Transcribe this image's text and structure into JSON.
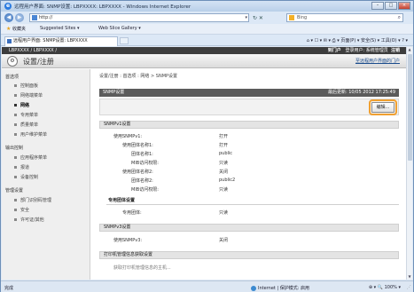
{
  "window": {
    "title": "远程用户界面: SNMP设置: LBPXXXX: LBPXXXX - Windows Internet Explorer",
    "minimize": "–",
    "maximize": "□",
    "close": "×"
  },
  "address_bar": {
    "back": "◀",
    "forward": "▶",
    "url": "http://",
    "refresh": "↻ ✕",
    "search_placeholder": "Bing",
    "search_glyph": "⌕"
  },
  "favorites_bar": {
    "favorites_label": "收藏夹",
    "suggested_sites": "Suggested Sites ▾",
    "web_slice_gallery": "Web Slice Gallery ▾"
  },
  "tab": {
    "label": "远程用户界面: SNMP设置: LBPXXXX"
  },
  "command_bar": {
    "text": "⌂ ▾  ☐ ▾  ✉ ▾  ⎙ ▾  页面(P) ▾  安全(S) ▾  工具(O) ▾  ? ▾"
  },
  "page_header": {
    "device_name": "LBPXXXX / LBPXXXX /",
    "to_portal": "到门户",
    "login_user_label": "登录用户:",
    "login_user_value": "系统管理员",
    "logout": "注销",
    "title": "设置/注册",
    "settings_icon_glyph": "⚙",
    "portal_link": "至远程用户界面的门户"
  },
  "sidebar": {
    "sections": [
      {
        "label": "首选项",
        "items": [
          "控制面板",
          "网络端菜单",
          "网络",
          "专用菜单",
          "质量菜单",
          "用户维护菜单"
        ]
      },
      {
        "label": "输出控制",
        "items": [
          "应用程序菜单",
          "报道",
          "设备控制"
        ]
      },
      {
        "label": "管理设置",
        "items": [
          "部门识别码管理",
          "安全",
          "许可证/其他"
        ]
      }
    ],
    "active_item": "网络"
  },
  "main": {
    "breadcrumb": "设置/注册 : 首选项 : 网络 > SNMP设置",
    "panel_title": "SNMP设置",
    "last_updated": "最后更新: 10/05 2012 17:25:49",
    "edit_button": "编辑...",
    "snmpv1": {
      "header": "SNMPv1设置",
      "rows": [
        {
          "label": "使用SNMPv1:",
          "value": "打开",
          "indent": 0
        },
        {
          "label": "使用团体名称1:",
          "value": "打开",
          "indent": 1
        },
        {
          "label": "团体名称1:",
          "value": "public",
          "indent": 2
        },
        {
          "label": "MIB访问权限:",
          "value": "只读",
          "indent": 2
        },
        {
          "label": "使用团体名称2:",
          "value": "关闭",
          "indent": 1
        },
        {
          "label": "团体名称2:",
          "value": "public2",
          "indent": 2
        },
        {
          "label": "MIB访问权限:",
          "value": "只读",
          "indent": 2
        }
      ]
    },
    "dedicated_community": {
      "header": "专用团体设置",
      "rows": [
        {
          "label": "专用团体:",
          "value": "只读"
        }
      ]
    },
    "snmpv3": {
      "header": "SNMPv3设置",
      "rows": [
        {
          "label": "使用SNMPv3:",
          "value": "关闭"
        }
      ]
    },
    "printer_mgmt_header": "打印机管理信息获取设置",
    "printer_mgmt_row": "获取打印机管理信息的主机..."
  },
  "statusbar": {
    "done": "完成",
    "zone": "Internet | 保护模式: 启用",
    "zoom": "⊕ ▾  🔍 100% ▾",
    "grip": "⋰"
  }
}
